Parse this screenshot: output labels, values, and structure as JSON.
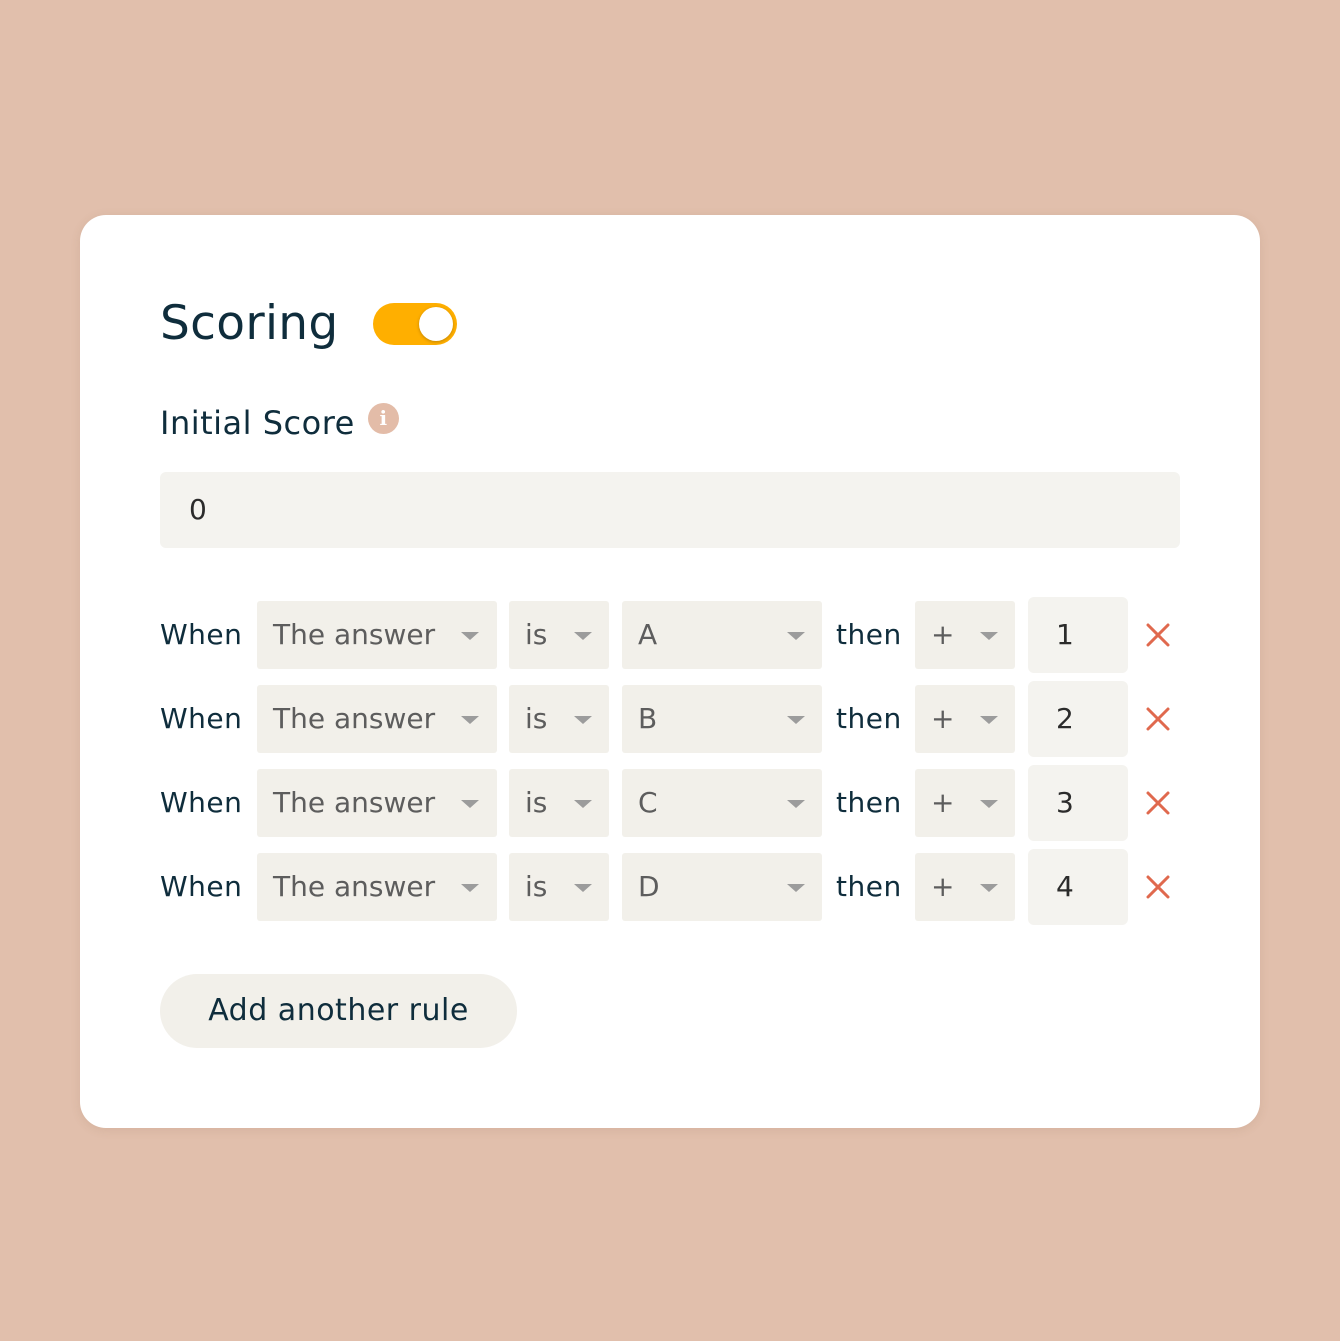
{
  "card": {
    "title": "Scoring",
    "toggle_on": true,
    "initial_score_label": "Initial Score",
    "info_glyph": "i",
    "initial_score_value": "0",
    "add_rule_label": "Add another rule"
  },
  "rules": [
    {
      "when": "When",
      "subject": "The answer",
      "operator": "is",
      "value": "A",
      "then": "then",
      "action": "+",
      "points": "1"
    },
    {
      "when": "When",
      "subject": "The answer",
      "operator": "is",
      "value": "B",
      "then": "then",
      "action": "+",
      "points": "2"
    },
    {
      "when": "When",
      "subject": "The answer",
      "operator": "is",
      "value": "C",
      "then": "then",
      "action": "+",
      "points": "3"
    },
    {
      "when": "When",
      "subject": "The answer",
      "operator": "is",
      "value": "D",
      "then": "then",
      "action": "+",
      "points": "4"
    }
  ],
  "colors": {
    "background": "#e1bfac",
    "card": "#ffffff",
    "toggle_accent": "#ffaf00",
    "remove_icon": "#e0694e",
    "info_icon": "#e3bca8",
    "field_bg": "#f2f0ea",
    "text": "#0f2d3c"
  },
  "icons": {
    "info": "info-icon",
    "remove": "close-icon",
    "dropdown": "chevron-down-icon"
  }
}
